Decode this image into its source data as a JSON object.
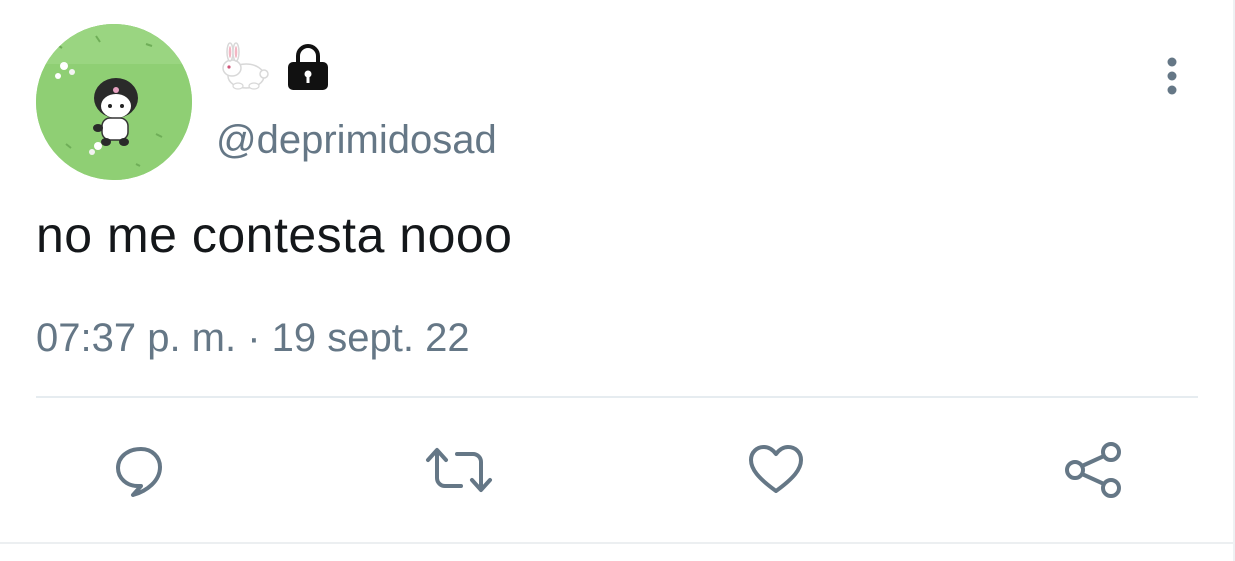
{
  "user": {
    "display_icons": [
      "rabbit-emoji-icon",
      "lock-icon"
    ],
    "handle": "@deprimidosad"
  },
  "tweet": {
    "text": "no me contesta nooo",
    "timestamp": "07:37 p. m. · 19 sept. 22"
  },
  "actions": {
    "icons": [
      "reply-icon",
      "retweet-icon",
      "like-icon",
      "share-icon"
    ]
  },
  "colors": {
    "text_primary": "#14171a",
    "text_secondary": "#657786",
    "icon": "#657786",
    "divider": "#e6ecf0",
    "avatar_green": "#8fcf74"
  }
}
